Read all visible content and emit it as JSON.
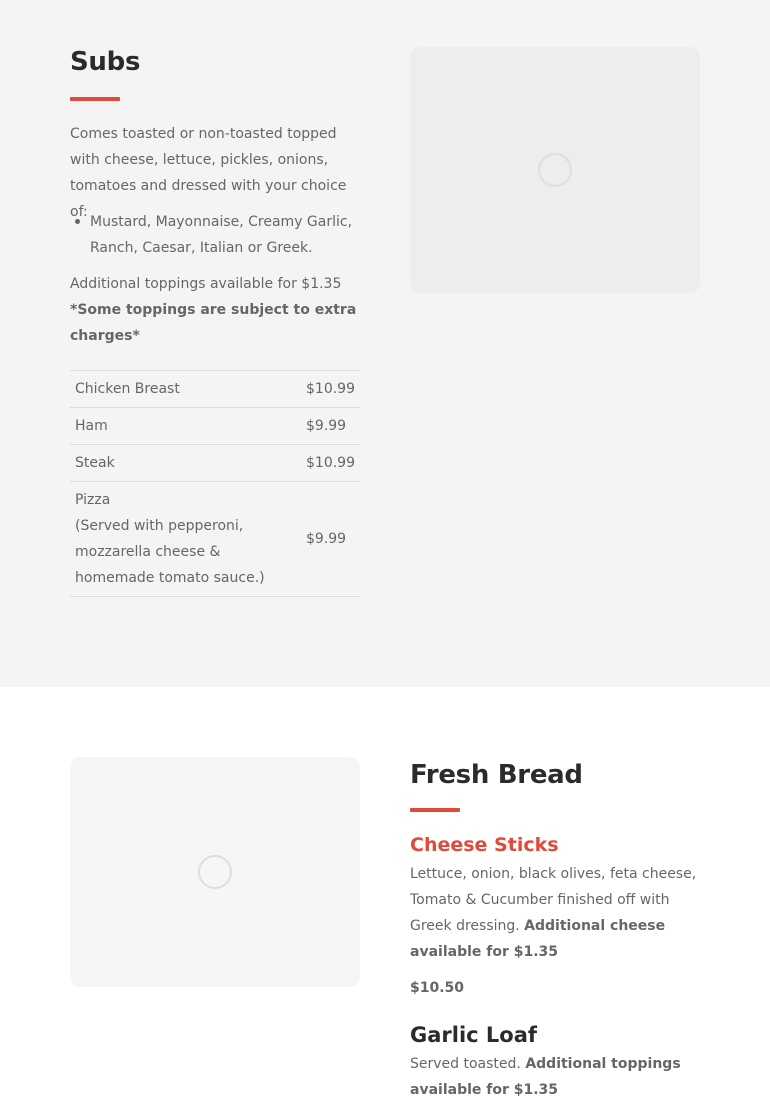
{
  "subs": {
    "title": "Subs",
    "description": "Comes toasted or non-toasted topped with cheese, lettuce, pickles, onions, tomatoes and dressed with your choice of:",
    "dressings": [
      "Mustard, Mayonnaise, Creamy Garlic, Ranch, Caesar, Italian or Greek."
    ],
    "additional_toppings": "Additional toppings available for $1.35",
    "extra_charges_note": "*Some toppings are subject to extra charges*",
    "items": [
      {
        "name": "Chicken Breast",
        "price": "$10.99"
      },
      {
        "name": "Ham",
        "price": "$9.99"
      },
      {
        "name": "Steak",
        "price": "$10.99"
      },
      {
        "name": "Pizza",
        "detail": "(Served with pepperoni, mozzarella cheese & homemade tomato sauce.)",
        "price": "$9.99"
      }
    ]
  },
  "fresh_bread": {
    "title": "Fresh Bread",
    "items": [
      {
        "name": "Cheese Sticks",
        "description": "Lettuce, onion, black olives, feta cheese, Tomato & Cucumber finished off with Greek dressing.",
        "note": "Additional cheese available for $1.35",
        "price": "$10.50"
      },
      {
        "name": "Garlic Loaf",
        "description": "Served toasted.",
        "note": "Additional toppings available for $1.35"
      }
    ]
  },
  "colors": {
    "accent": "#e04a3a",
    "section_bg": "#f4f4f4",
    "heading": "#2b2b2b",
    "text": "#666666"
  },
  "icons": {
    "loading": "loading-spinner-icon"
  }
}
